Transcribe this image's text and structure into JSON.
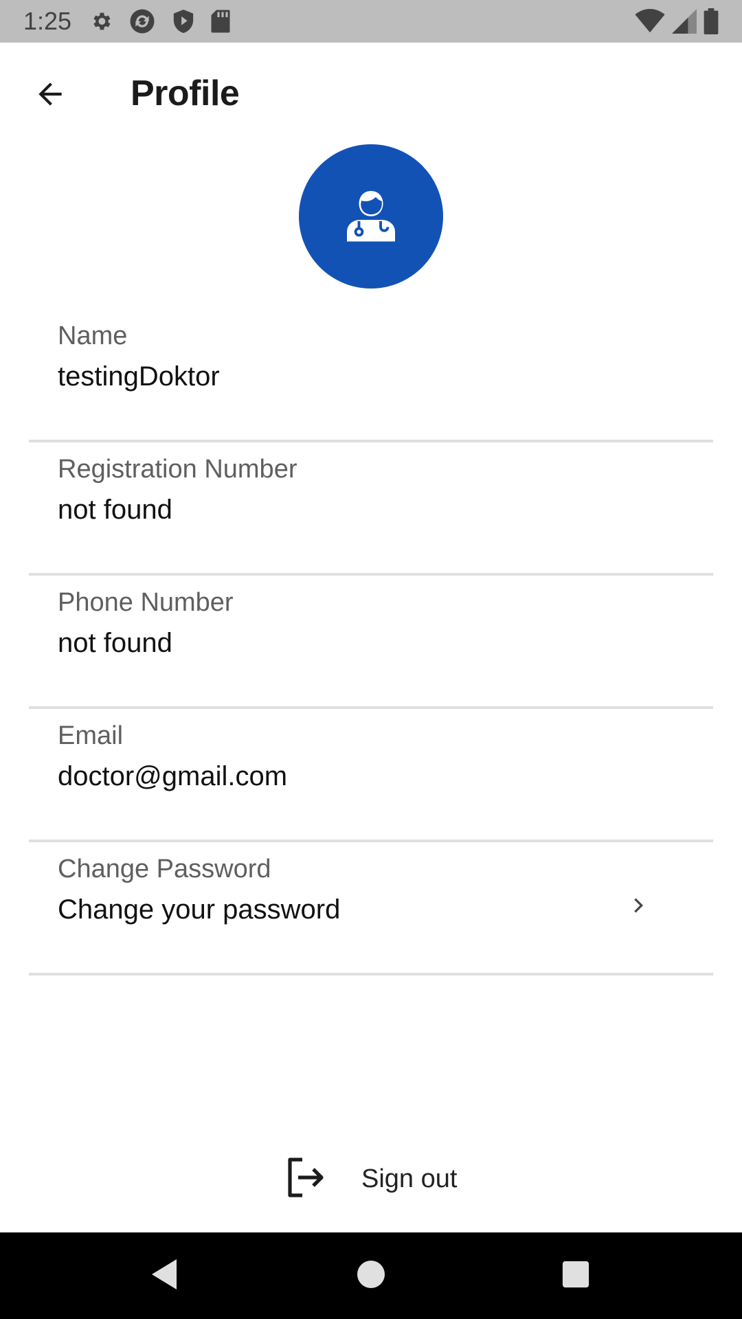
{
  "status_bar": {
    "time": "1:25",
    "left_icons": [
      "gear-icon",
      "sync-icon",
      "shield-play-icon",
      "sd-card-icon"
    ],
    "right_icons": [
      "wifi-icon",
      "signal-icon",
      "battery-icon"
    ]
  },
  "app_bar": {
    "title": "Profile",
    "back_icon": "arrow-left-icon"
  },
  "avatar": {
    "icon": "doctor-icon",
    "color": "#1252b5"
  },
  "fields": [
    {
      "label": "Name",
      "value": "testingDoktor"
    },
    {
      "label": "Registration Number",
      "value": "not found"
    },
    {
      "label": "Phone Number",
      "value": "not found"
    },
    {
      "label": "Email",
      "value": "doctor@gmail.com"
    },
    {
      "label": "Change Password",
      "value": "Change your password",
      "action_icon": "chevron-right-icon"
    }
  ],
  "sign_out": {
    "label": "Sign out",
    "icon": "logout-icon"
  },
  "nav_bar": {
    "buttons": [
      "back-triangle-icon",
      "home-circle-icon",
      "recents-square-icon"
    ]
  }
}
